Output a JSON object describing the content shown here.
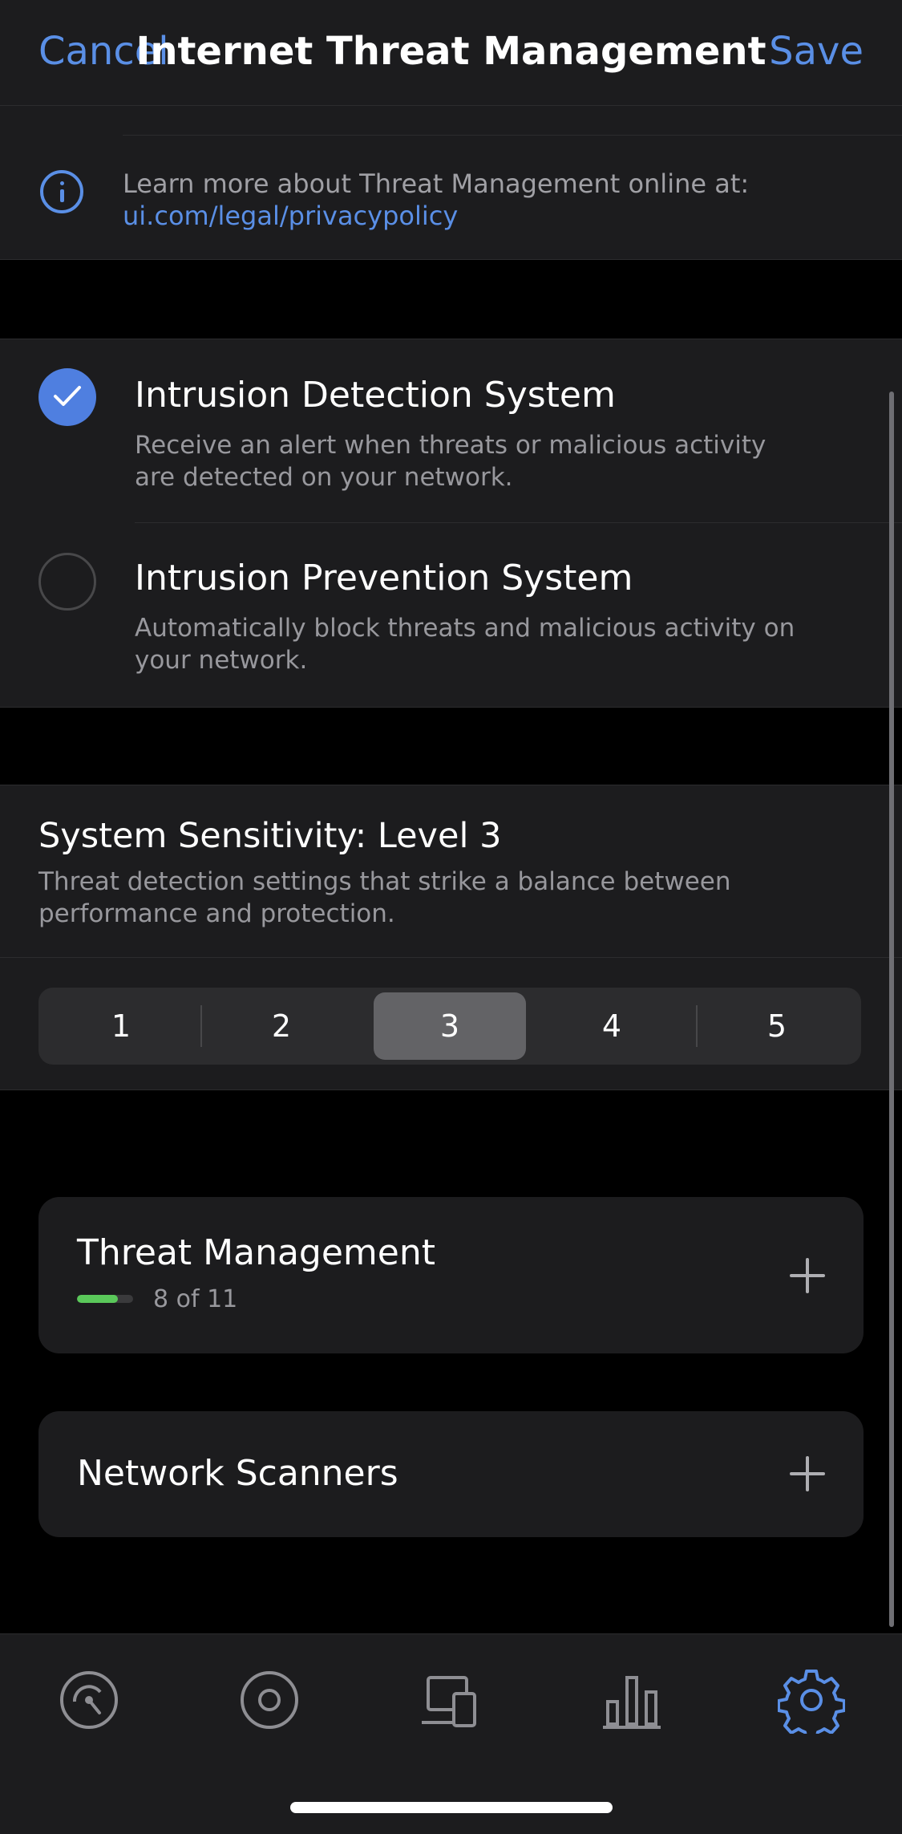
{
  "nav": {
    "cancel_label": "Cancel",
    "title": "Internet Threat Management",
    "save_label": "Save"
  },
  "info": {
    "text": "Learn more about Threat Management online at:",
    "link": "ui.com/legal/privacypolicy"
  },
  "options": [
    {
      "title": "Intrusion Detection System",
      "description": "Receive an alert when threats or malicious activity are detected on your network.",
      "checked": true
    },
    {
      "title": "Intrusion Prevention System",
      "description": "Automatically block threats and malicious activity on your network.",
      "checked": false
    }
  ],
  "sensitivity": {
    "title": "System Sensitivity: Level 3",
    "description": "Threat detection settings that strike a balance between performance and protection.",
    "levels": [
      "1",
      "2",
      "3",
      "4",
      "5"
    ],
    "selected": "3"
  },
  "cards": {
    "threat_management": {
      "title": "Threat Management",
      "progress_text": "8 of 11",
      "progress_fraction": 0.727
    },
    "network_scanners": {
      "title": "Network Scanners"
    }
  },
  "tabbar": {
    "tabs": [
      "dashboard-icon",
      "unifi-devices-icon",
      "client-devices-icon",
      "statistics-icon",
      "settings-icon"
    ],
    "active": "settings-icon"
  },
  "colors": {
    "accent": "#5a8fe6",
    "check": "#4f7fe0",
    "progress": "#5ac85a"
  }
}
